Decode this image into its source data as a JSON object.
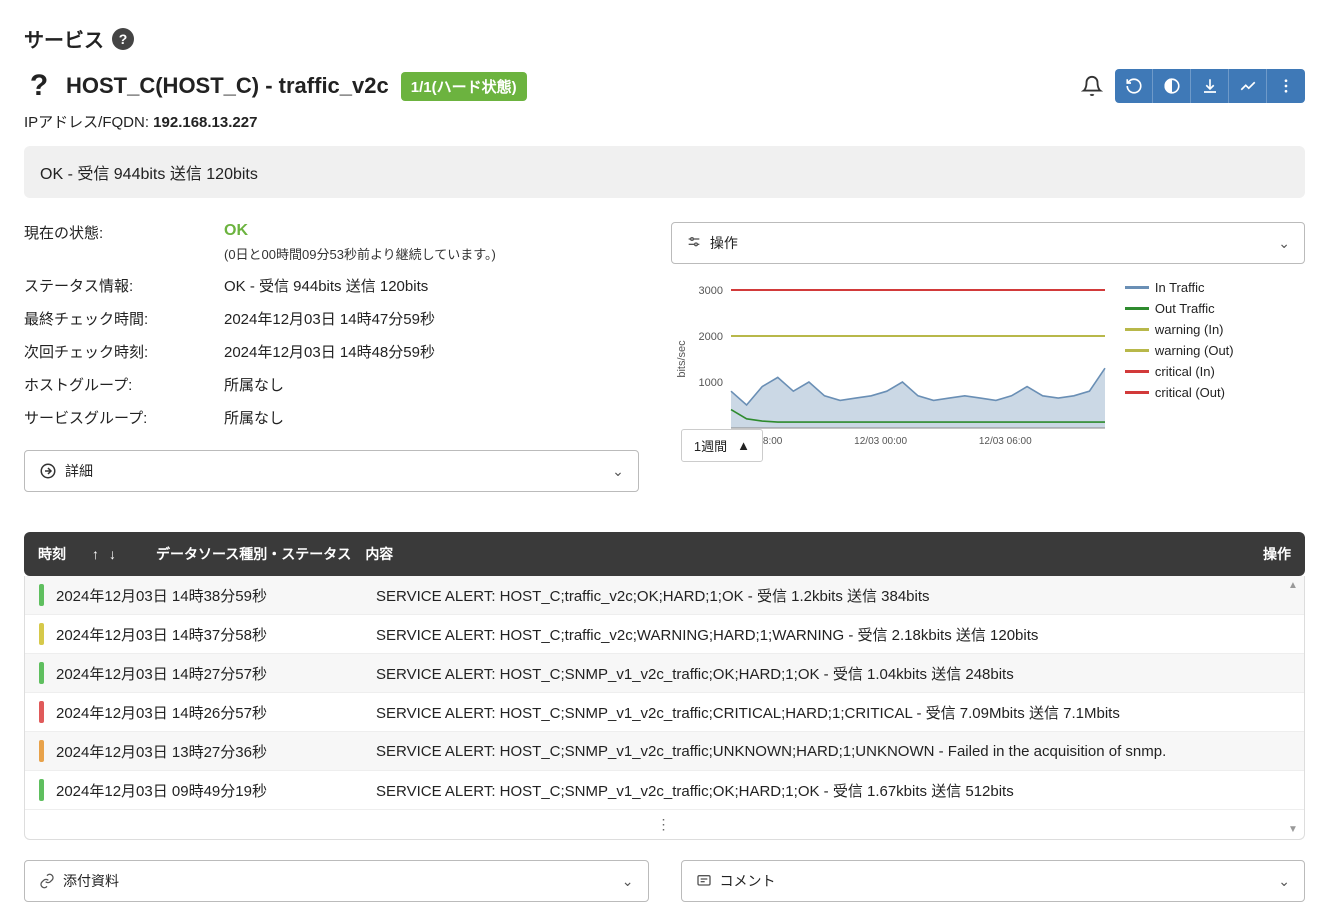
{
  "page": {
    "title": "サービス"
  },
  "header": {
    "host_title": "HOST_C(HOST_C) - traffic_v2c",
    "badge": "1/1(ハード状態)",
    "ip_label": "IPアドレス/FQDN: ",
    "ip_value": "192.168.13.227"
  },
  "status_banner": "OK - 受信 944bits 送信 120bits",
  "info": {
    "labels": {
      "current_state": "現在の状態:",
      "status_info": "ステータス情報:",
      "last_check": "最終チェック時間:",
      "next_check": "次回チェック時刻:",
      "host_group": "ホストグループ:",
      "service_group": "サービスグループ:"
    },
    "values": {
      "state": "OK",
      "duration": "(0日と00時間09分53秒前より継続しています。)",
      "status_info": "OK - 受信 944bits 送信 120bits",
      "last_check": "2024年12月03日 14時47分59秒",
      "next_check": "2024年12月03日 14時48分59秒",
      "host_group": "所属なし",
      "service_group": "所属なし"
    }
  },
  "detail_panel": {
    "label": "詳細"
  },
  "ops_panel": {
    "label": "操作"
  },
  "chart_data": {
    "type": "line",
    "ylabel": "bits/sec",
    "ylim": [
      0,
      3000
    ],
    "yticks": [
      1000,
      2000,
      3000
    ],
    "xticks": [
      "12/02 18:00",
      "12/03 00:00",
      "12/03 06:00"
    ],
    "series": [
      {
        "name": "In Traffic",
        "color": "#6a8fb5",
        "fill": true,
        "values": [
          800,
          500,
          900,
          1100,
          800,
          1000,
          700,
          600,
          650,
          700,
          800,
          1000,
          700,
          600,
          650,
          700,
          650,
          600,
          700,
          900,
          700,
          650,
          700,
          800,
          1300
        ]
      },
      {
        "name": "Out Traffic",
        "color": "#2e8b2e",
        "fill": false,
        "values": [
          400,
          200,
          150,
          130,
          130,
          130,
          130,
          130,
          130,
          130,
          130,
          130,
          130,
          130,
          130,
          130,
          130,
          130,
          130,
          130,
          130,
          130,
          130,
          130,
          130
        ]
      },
      {
        "name": "warning (In)",
        "color": "#b8b84a",
        "fill": false,
        "constant": 2000
      },
      {
        "name": "warning (Out)",
        "color": "#b8b84a",
        "fill": false,
        "constant": 2000
      },
      {
        "name": "critical (In)",
        "color": "#d23a3a",
        "fill": false,
        "constant": 3000
      },
      {
        "name": "critical (Out)",
        "color": "#d23a3a",
        "fill": false,
        "constant": 3000
      }
    ],
    "range_label": "1週間"
  },
  "log_header": {
    "time": "時刻",
    "ds": "データソース種別・ステータス",
    "content": "内容",
    "ops": "操作"
  },
  "log_rows": [
    {
      "color": "#5fbf5f",
      "time": "2024年12月03日 14時38分59秒",
      "content": "SERVICE ALERT: HOST_C;traffic_v2c;OK;HARD;1;OK - 受信 1.2kbits 送信 384bits"
    },
    {
      "color": "#d6c94a",
      "time": "2024年12月03日 14時37分58秒",
      "content": "SERVICE ALERT: HOST_C;traffic_v2c;WARNING;HARD;1;WARNING - 受信 2.18kbits 送信 120bits"
    },
    {
      "color": "#5fbf5f",
      "time": "2024年12月03日 14時27分57秒",
      "content": "SERVICE ALERT: HOST_C;SNMP_v1_v2c_traffic;OK;HARD;1;OK - 受信 1.04kbits 送信 248bits"
    },
    {
      "color": "#e05a5a",
      "time": "2024年12月03日 14時26分57秒",
      "content": "SERVICE ALERT: HOST_C;SNMP_v1_v2c_traffic;CRITICAL;HARD;1;CRITICAL - 受信 7.09Mbits 送信 7.1Mbits"
    },
    {
      "color": "#e8a24a",
      "time": "2024年12月03日 13時27分36秒",
      "content": "SERVICE ALERT: HOST_C;SNMP_v1_v2c_traffic;UNKNOWN;HARD;1;UNKNOWN - Failed in the acquisition of snmp."
    },
    {
      "color": "#5fbf5f",
      "time": "2024年12月03日 09時49分19秒",
      "content": "SERVICE ALERT: HOST_C;SNMP_v1_v2c_traffic;OK;HARD;1;OK - 受信 1.67kbits 送信 512bits"
    }
  ],
  "bottom_panels": {
    "attachments": "添付資料",
    "comments": "コメント"
  }
}
